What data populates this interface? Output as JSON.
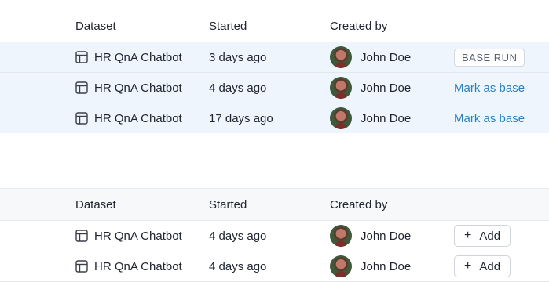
{
  "table1": {
    "headers": {
      "dataset": "Dataset",
      "started": "Started",
      "created_by": "Created by"
    },
    "rows": [
      {
        "dataset": "HR QnA Chatbot",
        "started": "3 days ago",
        "user": "John Doe",
        "action": "BASE RUN"
      },
      {
        "dataset": "HR QnA Chatbot",
        "started": "4 days ago",
        "user": "John Doe",
        "action": "Mark as base"
      },
      {
        "dataset": "HR QnA Chatbot",
        "started": "17 days ago",
        "user": "John Doe",
        "action": "Mark as base"
      }
    ]
  },
  "table2": {
    "headers": {
      "dataset": "Dataset",
      "started": "Started",
      "created_by": "Created by"
    },
    "rows": [
      {
        "dataset": "HR QnA Chatbot",
        "started": "4 days ago",
        "user": "John Doe",
        "action": "Add"
      },
      {
        "dataset": "HR QnA Chatbot",
        "started": "4 days ago",
        "user": "John Doe",
        "action": "Add"
      }
    ]
  },
  "icons": {
    "dataset": "table-icon",
    "add": "plus-icon"
  },
  "colors": {
    "row_highlight": "#eef5fc",
    "link": "#2b7fc0"
  }
}
